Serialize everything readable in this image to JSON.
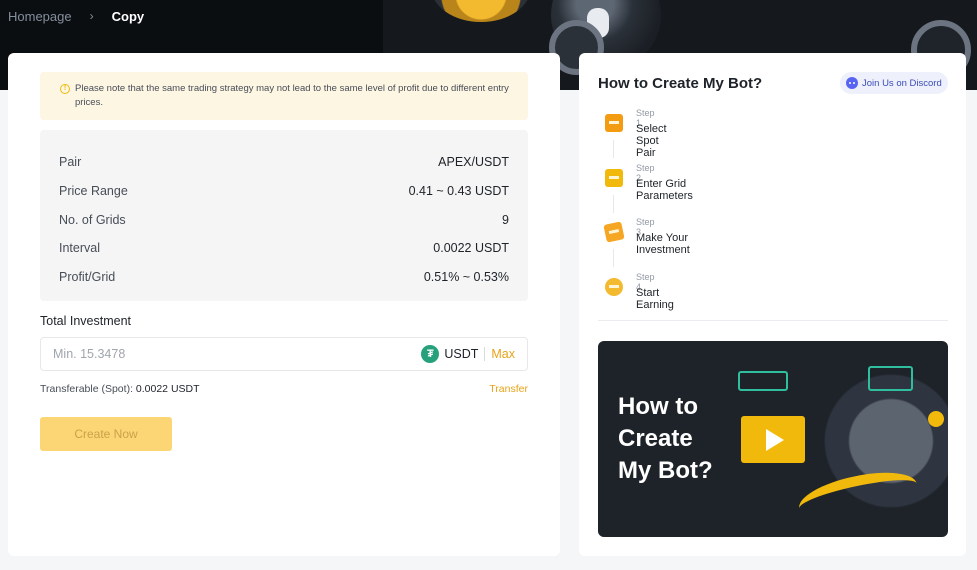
{
  "breadcrumb": {
    "home": "Homepage",
    "current": "Copy"
  },
  "notice": {
    "text": "Please note that the same trading strategy may not lead to the same level of profit due to different entry prices."
  },
  "details": [
    {
      "label": "Pair",
      "value": "APEX/USDT"
    },
    {
      "label": "Price Range",
      "value": "0.41 ~ 0.43 USDT"
    },
    {
      "label": "No. of Grids",
      "value": "9"
    },
    {
      "label": "Interval",
      "value": "0.0022 USDT"
    },
    {
      "label": "Profit/Grid",
      "value": "0.51% ~ 0.53%"
    }
  ],
  "investment": {
    "label": "Total Investment",
    "placeholder": "Min. 15.3478",
    "unit": "USDT",
    "max_label": "Max",
    "transferable_label": "Transferable (Spot):",
    "transferable_value": "0.0022 USDT",
    "transfer_link": "Transfer",
    "create_button": "Create Now"
  },
  "howto": {
    "title": "How to Create My Bot?",
    "discord_label": "Join Us on Discord",
    "steps": [
      {
        "label": "Step 1",
        "title": "Select Spot Pair"
      },
      {
        "label": "Step 2",
        "title": "Enter Grid Parameters"
      },
      {
        "label": "Step 3",
        "title": "Make Your Investment"
      },
      {
        "label": "Step 4",
        "title": "Start Earning"
      }
    ],
    "video_title": "How to Create My Bot?"
  },
  "colors": {
    "accent": "#f0b90b",
    "link": "#e8a317",
    "usdt": "#26a17b",
    "discord": "#5865f2"
  }
}
